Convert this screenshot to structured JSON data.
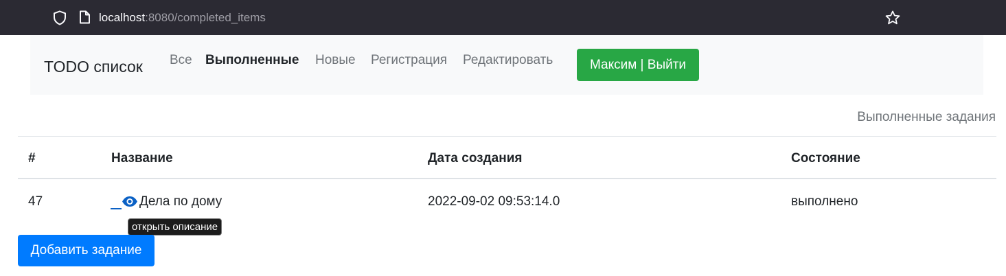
{
  "browser": {
    "url_host": "localhost",
    "url_rest": ":8080/completed_items"
  },
  "navbar": {
    "brand": "TODO список",
    "links": [
      {
        "label": "Все",
        "active": false
      },
      {
        "label": "Выполненные",
        "active": true
      },
      {
        "label": "Новые",
        "active": false
      },
      {
        "label": "Регистрация",
        "active": false
      },
      {
        "label": "Редактировать",
        "active": false
      }
    ],
    "user_button": "Максим | Выйти"
  },
  "page": {
    "heading": "Выполненные задания"
  },
  "table": {
    "headers": [
      "#",
      "Название",
      "Дата создания",
      "Состояние"
    ],
    "rows": [
      {
        "id": "47",
        "name": "Дела по дому",
        "created": "2022-09-02 09:53:14.0",
        "state": "выполнено"
      }
    ]
  },
  "tooltip": "открыть описание",
  "add_button": "Добавить задание",
  "colors": {
    "chrome_bg": "#2b2a33",
    "navbar_bg": "#f8f9fa",
    "success": "#28a745",
    "primary": "#007bff",
    "link": "#0b61c5"
  },
  "icons": [
    "shield-icon",
    "page-icon",
    "bookmark-star-icon",
    "eye-icon"
  ]
}
